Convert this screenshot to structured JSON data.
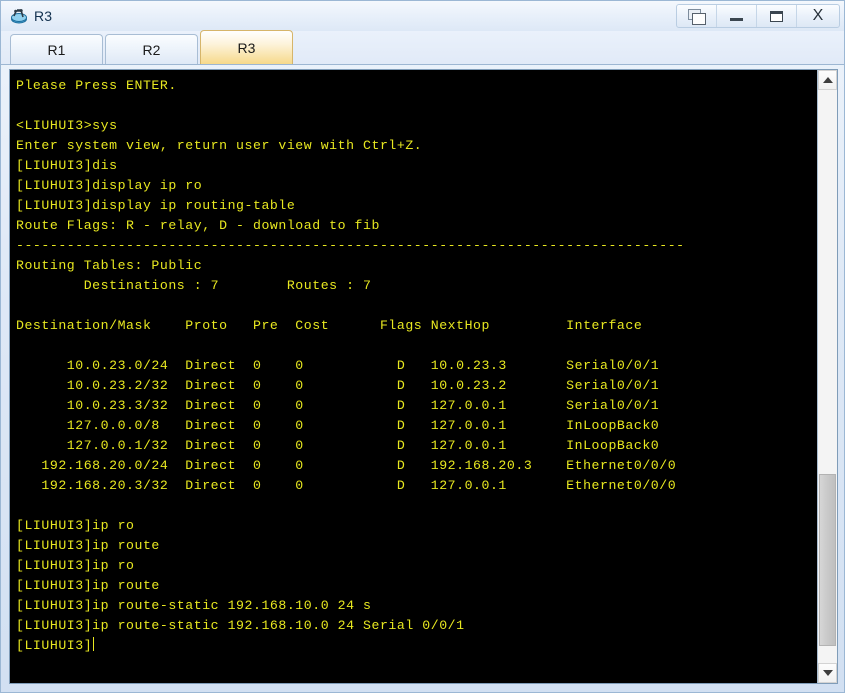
{
  "window": {
    "title": "R3",
    "icon": "router-icon",
    "controls": [
      {
        "name": "restore-window-button",
        "glyph": "restore"
      },
      {
        "name": "minimize-window-button",
        "glyph": "minimize"
      },
      {
        "name": "maximize-window-button",
        "glyph": "maximize"
      },
      {
        "name": "close-window-button",
        "glyph": "X"
      }
    ]
  },
  "tabs": [
    {
      "label": "R1",
      "active": false
    },
    {
      "label": "R2",
      "active": false
    },
    {
      "label": "R3",
      "active": true
    }
  ],
  "terminal": {
    "foreground_color": "#e8e820",
    "background_color": "#000000",
    "cursor_visible": true,
    "lines": [
      "Please Press ENTER.",
      "",
      "<LIUHUI3>sys",
      "Enter system view, return user view with Ctrl+Z.",
      "[LIUHUI3]dis",
      "[LIUHUI3]display ip ro",
      "[LIUHUI3]display ip routing-table",
      "Route Flags: R - relay, D - download to fib",
      "-------------------------------------------------------------------------------",
      "Routing Tables: Public",
      "        Destinations : 7        Routes : 7",
      "",
      "Destination/Mask    Proto   Pre  Cost      Flags NextHop         Interface",
      "",
      "      10.0.23.0/24  Direct  0    0           D   10.0.23.3       Serial0/0/1",
      "      10.0.23.2/32  Direct  0    0           D   10.0.23.2       Serial0/0/1",
      "      10.0.23.3/32  Direct  0    0           D   127.0.0.1       Serial0/0/1",
      "      127.0.0.0/8   Direct  0    0           D   127.0.0.1       InLoopBack0",
      "      127.0.0.1/32  Direct  0    0           D   127.0.0.1       InLoopBack0",
      "   192.168.20.0/24  Direct  0    0           D   192.168.20.3    Ethernet0/0/0",
      "   192.168.20.3/32  Direct  0    0           D   127.0.0.1       Ethernet0/0/0",
      "",
      "[LIUHUI3]ip ro",
      "[LIUHUI3]ip route",
      "[LIUHUI3]ip ro",
      "[LIUHUI3]ip route",
      "[LIUHUI3]ip route-static 192.168.10.0 24 s",
      "[LIUHUI3]ip route-static 192.168.10.0 24 Serial 0/0/1"
    ],
    "prompt_line": "[LIUHUI3]",
    "routing_table": {
      "flags_legend": "Route Flags: R - relay, D - download to fib",
      "table_name": "Routing Tables: Public",
      "destinations": "7",
      "routes": "7",
      "columns": [
        "Destination/Mask",
        "Proto",
        "Pre",
        "Cost",
        "Flags",
        "NextHop",
        "Interface"
      ],
      "rows": [
        {
          "destination_mask": "10.0.23.0/24",
          "proto": "Direct",
          "pre": "0",
          "cost": "0",
          "flags": "D",
          "nexthop": "10.0.23.3",
          "interface": "Serial0/0/1"
        },
        {
          "destination_mask": "10.0.23.2/32",
          "proto": "Direct",
          "pre": "0",
          "cost": "0",
          "flags": "D",
          "nexthop": "10.0.23.2",
          "interface": "Serial0/0/1"
        },
        {
          "destination_mask": "10.0.23.3/32",
          "proto": "Direct",
          "pre": "0",
          "cost": "0",
          "flags": "D",
          "nexthop": "127.0.0.1",
          "interface": "Serial0/0/1"
        },
        {
          "destination_mask": "127.0.0.0/8",
          "proto": "Direct",
          "pre": "0",
          "cost": "0",
          "flags": "D",
          "nexthop": "127.0.0.1",
          "interface": "InLoopBack0"
        },
        {
          "destination_mask": "127.0.0.1/32",
          "proto": "Direct",
          "pre": "0",
          "cost": "0",
          "flags": "D",
          "nexthop": "127.0.0.1",
          "interface": "InLoopBack0"
        },
        {
          "destination_mask": "192.168.20.0/24",
          "proto": "Direct",
          "pre": "0",
          "cost": "0",
          "flags": "D",
          "nexthop": "192.168.20.3",
          "interface": "Ethernet0/0/0"
        },
        {
          "destination_mask": "192.168.20.3/32",
          "proto": "Direct",
          "pre": "0",
          "cost": "0",
          "flags": "D",
          "nexthop": "127.0.0.1",
          "interface": "Ethernet0/0/0"
        }
      ]
    }
  },
  "scrollbar": {
    "up_arrow": "scroll-up",
    "down_arrow": "scroll-down",
    "thumb_top_percent": 67,
    "thumb_height_percent": 30
  }
}
